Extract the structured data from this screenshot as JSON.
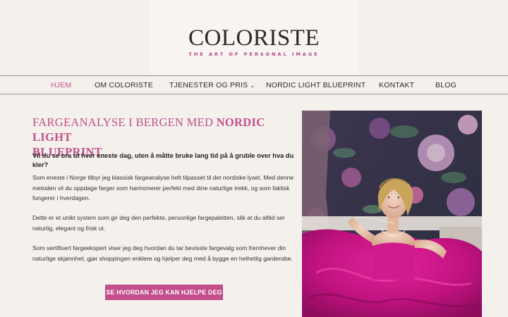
{
  "header": {
    "logo": "COLORISTE",
    "tagline": "THE ART OF PERSONAL IMAGE"
  },
  "nav": {
    "items": [
      {
        "label": "HJEM",
        "active": true
      },
      {
        "label": "OM COLORISTE"
      },
      {
        "label": "TJENESTER OG PRIS",
        "has_dropdown": true
      },
      {
        "label": "NORDIC LIGHT BLUEPRINT"
      },
      {
        "label": "KONTAKT"
      },
      {
        "label": "BLOG"
      }
    ]
  },
  "main": {
    "heading_line1_plain": "FARGEANALYSE I BERGEN MED ",
    "heading_line1_bold": "NORDIC LIGHT",
    "heading_line2_bold": "BLUEPRINT",
    "heading_line2_end": ".",
    "subheading": "Vil du se bra ut hver eneste dag, uten å måtte bruke lang tid på å gruble over hva du kler?",
    "paragraphs": [
      "Som eneste i Norge tilbyr jeg klassisk fargeanalyse helt tilpasset til det nordiske lyset. Med denne metoden vil du oppdage farger som harmonerer perfekt med dine naturlige trekk, og som faktisk fungerer i hverdagen.",
      "Dette er et unikt system som gir deg den perfekte, personlige fargepaletten, slik at du alltid ser naturlig, elegant og frisk ut.",
      "Som sertifisert fargeekspert viser jeg deg hvordan du tar bevisste fargevalg som fremhever din naturlige skjønnhet, gjør shoppingen enklere og hjelper deg med å bygge en helhetlig garderobe."
    ],
    "cta_label": "SE HVORDAN JEG KAN HJELPE DEG"
  },
  "colors": {
    "accent": "#c24e8c",
    "background": "#f4f0ec",
    "text": "#2b2b2b"
  }
}
